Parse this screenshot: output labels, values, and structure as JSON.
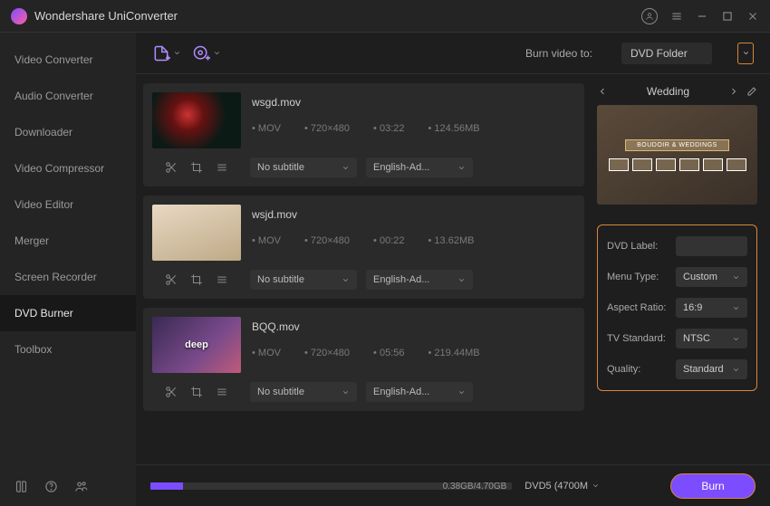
{
  "titlebar": {
    "title": "Wondershare UniConverter"
  },
  "sidebar": {
    "items": [
      {
        "label": "Video Converter"
      },
      {
        "label": "Audio Converter"
      },
      {
        "label": "Downloader"
      },
      {
        "label": "Video Compressor"
      },
      {
        "label": "Video Editor"
      },
      {
        "label": "Merger"
      },
      {
        "label": "Screen Recorder"
      },
      {
        "label": "DVD Burner"
      },
      {
        "label": "Toolbox"
      }
    ],
    "active_index": 7
  },
  "toolbar": {
    "burn_to_label": "Burn video to:",
    "burn_to_value": "DVD Folder"
  },
  "files": [
    {
      "name": "wsgd.mov",
      "format": "MOV",
      "resolution": "720×480",
      "duration": "03:22",
      "size": "124.56MB",
      "subtitle": "No subtitle",
      "audio": "English-Ad..."
    },
    {
      "name": "wsjd.mov",
      "format": "MOV",
      "resolution": "720×480",
      "duration": "00:22",
      "size": "13.62MB",
      "subtitle": "No subtitle",
      "audio": "English-Ad..."
    },
    {
      "name": "BQQ.mov",
      "format": "MOV",
      "resolution": "720×480",
      "duration": "05:56",
      "size": "219.44MB",
      "subtitle": "No subtitle",
      "audio": "English-Ad..."
    }
  ],
  "template": {
    "name": "Wedding",
    "banner": "BOUDOIR & WEDDINGS"
  },
  "settings": {
    "dvd_label_label": "DVD Label:",
    "dvd_label_value": "",
    "menu_type_label": "Menu Type:",
    "menu_type_value": "Custom",
    "aspect_ratio_label": "Aspect Ratio:",
    "aspect_ratio_value": "16:9",
    "tv_standard_label": "TV Standard:",
    "tv_standard_value": "NTSC",
    "quality_label": "Quality:",
    "quality_value": "Standard"
  },
  "footer": {
    "progress_text": "0.38GB/4.70GB",
    "disc_value": "DVD5 (4700M",
    "burn_label": "Burn"
  },
  "thumb_labels": {
    "t3": "deep"
  }
}
